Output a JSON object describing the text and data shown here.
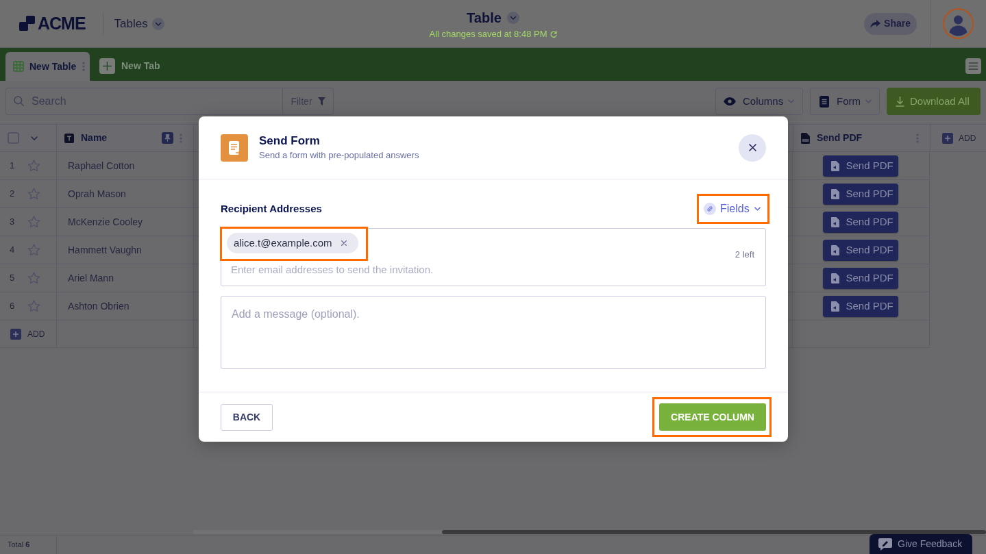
{
  "header": {
    "logo": "ACME",
    "workspace": "Tables",
    "title": "Table",
    "save_status": "All changes saved at 8:48 PM",
    "share": "Share"
  },
  "tabs": [
    {
      "label": "New Table",
      "selected": true
    }
  ],
  "new_tab": "New Tab",
  "toolbar": {
    "search": {
      "placeholder": "Search"
    },
    "filter": "Filter",
    "columns": "Columns",
    "form": "Form",
    "download": "Download All"
  },
  "table": {
    "select_all": {
      "checked": false
    },
    "columns": [
      {
        "label": "Name",
        "kind": "text",
        "pinned": true
      },
      {
        "label": "Send PDF",
        "kind": "pdf",
        "pinned": false
      }
    ],
    "add_column": "ADD",
    "rows": [
      {
        "number": "1",
        "starred": false,
        "name": "Raphael Cotton",
        "action": "Send PDF"
      },
      {
        "number": "2",
        "starred": false,
        "name": "Oprah Mason",
        "action": "Send PDF"
      },
      {
        "number": "3",
        "starred": false,
        "name": "McKenzie Cooley",
        "action": "Send PDF"
      },
      {
        "number": "4",
        "starred": false,
        "name": "Hammett Vaughn",
        "action": "Send PDF"
      },
      {
        "number": "5",
        "starred": false,
        "name": "Ariel Mann",
        "action": "Send PDF"
      },
      {
        "number": "6",
        "starred": false,
        "name": "Ashton Obrien",
        "action": "Send PDF"
      }
    ],
    "add_row": "ADD"
  },
  "footer": {
    "total": "Total **6**",
    "feedback": "Give Feedback"
  },
  "modal": {
    "title": "Send Form",
    "subtitle": "Send a form with pre-populated answers",
    "section": "Recipient Addresses",
    "fields_button": {
      "label": "Fields",
      "highlighted": true
    },
    "recipients": [
      {
        "email": "alice.t@example.com",
        "highlighted": true
      }
    ],
    "remaining": "2 left",
    "email_field": {
      "placeholder": "Enter email addresses to send the invitation."
    },
    "message_field": {
      "placeholder": "Add a message (optional)."
    },
    "back": "BACK",
    "submit": {
      "label": "CREATE COLUMN",
      "highlighted": true
    }
  }
}
